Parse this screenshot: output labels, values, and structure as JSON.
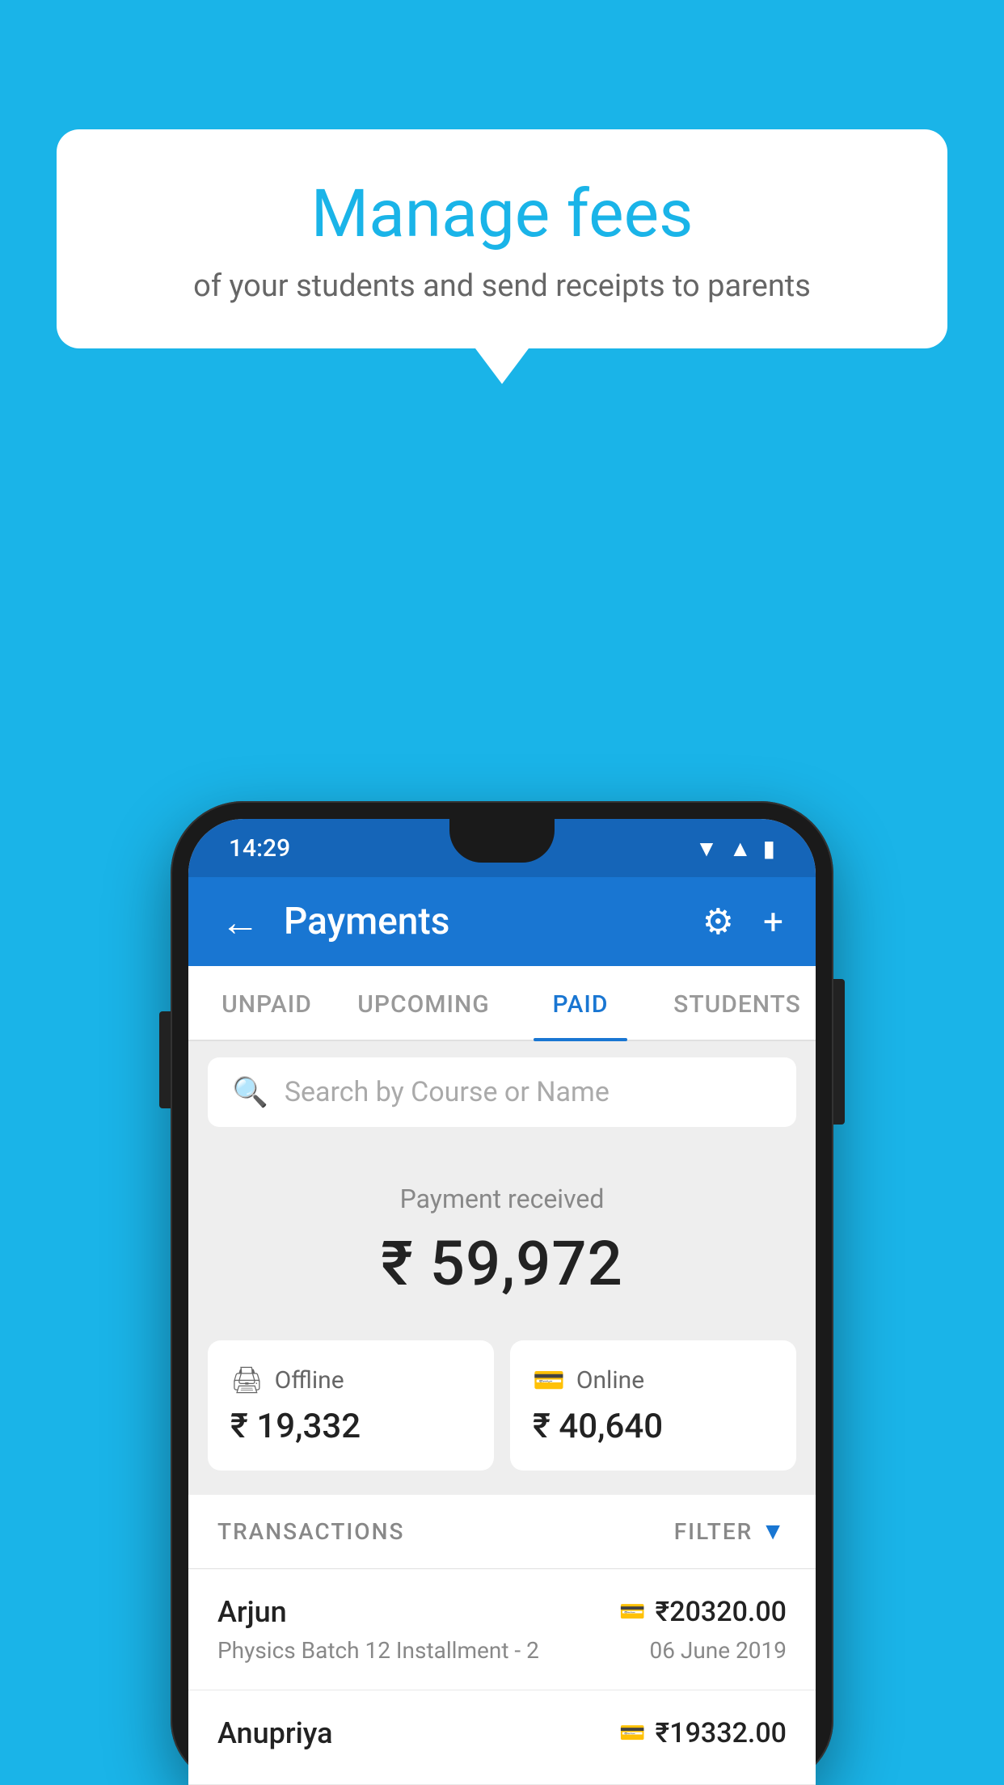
{
  "page": {
    "background_color": "#1ab4e8"
  },
  "speech_bubble": {
    "title": "Manage fees",
    "subtitle": "of your students and send receipts to parents"
  },
  "status_bar": {
    "time": "14:29",
    "wifi": "▲",
    "signal": "▲",
    "battery": "▪"
  },
  "app_bar": {
    "title": "Payments",
    "back_label": "←",
    "gear_label": "⚙",
    "plus_label": "+"
  },
  "tabs": [
    {
      "id": "unpaid",
      "label": "UNPAID",
      "active": false
    },
    {
      "id": "upcoming",
      "label": "UPCOMING",
      "active": false
    },
    {
      "id": "paid",
      "label": "PAID",
      "active": true
    },
    {
      "id": "students",
      "label": "STUDENTS",
      "active": false
    }
  ],
  "search": {
    "placeholder": "Search by Course or Name"
  },
  "payment_received": {
    "label": "Payment received",
    "amount": "₹ 59,972"
  },
  "cards": [
    {
      "id": "offline",
      "icon": "💳",
      "label": "Offline",
      "amount": "₹ 19,332"
    },
    {
      "id": "online",
      "icon": "💳",
      "label": "Online",
      "amount": "₹ 40,640"
    }
  ],
  "transactions_section": {
    "label": "TRANSACTIONS",
    "filter_label": "FILTER",
    "filter_icon": "▼"
  },
  "transactions": [
    {
      "name": "Arjun",
      "detail": "Physics Batch 12 Installment - 2",
      "amount": "₹20320.00",
      "date": "06 June 2019",
      "icon": "💳"
    },
    {
      "name": "Anupriya",
      "detail": "",
      "amount": "₹19332.00",
      "date": "",
      "icon": "💳"
    }
  ]
}
